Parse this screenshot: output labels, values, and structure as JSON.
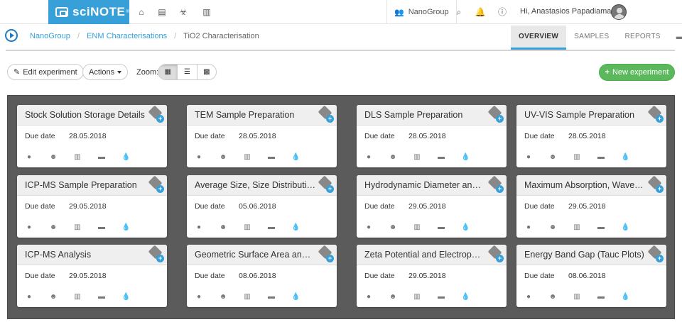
{
  "brand": {
    "name": "sciNOTE",
    "tm": "®",
    "color": "#37a0d9"
  },
  "topbar": {
    "icons": [
      "home-icon",
      "list-icon",
      "biohazard-icon",
      "reports-icon"
    ],
    "team_label": "NanoGroup",
    "greeting": "Hi, Anastasios Papadiamantis"
  },
  "breadcrumb": {
    "project_group": "NanoGroup",
    "project": "ENM Characterisations",
    "experiment": "TiO2 Characterisation"
  },
  "tabs": [
    {
      "label": "OVERVIEW",
      "active": true
    },
    {
      "label": "SAMPLES",
      "active": false
    },
    {
      "label": "REPORTS",
      "active": false
    }
  ],
  "toolbar": {
    "edit_label": "Edit experiment",
    "actions_label": "Actions",
    "zoom_label": "Zoom:",
    "new_experiment_label": "New experiment"
  },
  "due_label": "Due date",
  "cards": [
    {
      "title": "Stock Solution Storage Details",
      "due": "28.05.2018"
    },
    {
      "title": "TEM Sample Preparation",
      "due": "28.05.2018"
    },
    {
      "title": "DLS Sample Preparation",
      "due": "28.05.2018"
    },
    {
      "title": "UV-VIS Sample Preparation",
      "due": "28.05.2018"
    },
    {
      "title": "ICP-MS Sample Preparation",
      "due": "29.05.2018"
    },
    {
      "title": "Average Size, Size Distribution i...",
      "due": "05.06.2018"
    },
    {
      "title": "Hydrodynamic Diameter and PDI",
      "due": "29.05.2018"
    },
    {
      "title": "Maximum Absorption, Wavelen...",
      "due": "29.05.2018"
    },
    {
      "title": "ICP-MS Analysis",
      "due": "29.05.2018"
    },
    {
      "title": "Geometric Surface Area and Co...",
      "due": "08.06.2018"
    },
    {
      "title": "Zeta Potential and Electrophore...",
      "due": "29.05.2018"
    },
    {
      "title": "Energy Band Gap (Tauc Plots)",
      "due": "08.06.2018"
    }
  ]
}
